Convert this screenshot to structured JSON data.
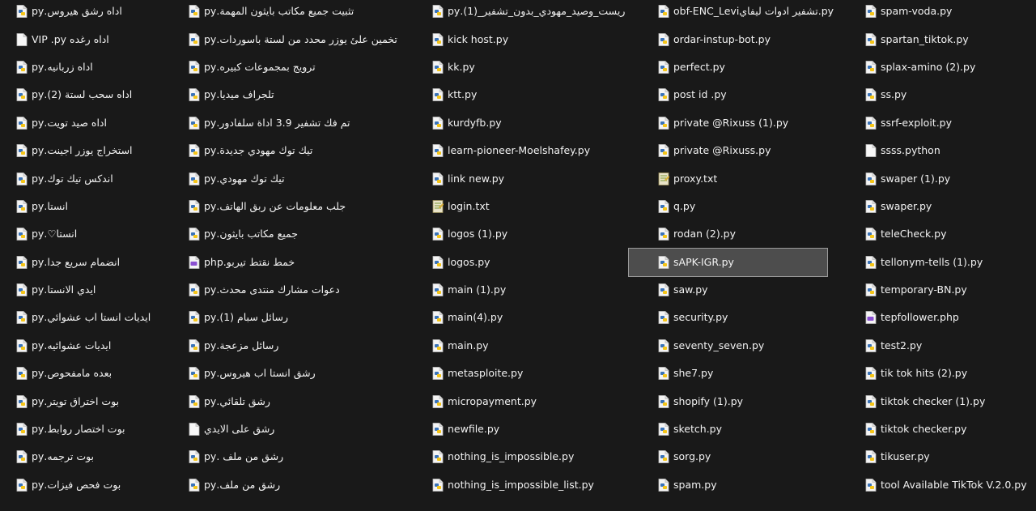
{
  "colors": {
    "background": "#191919",
    "text": "#f2f2f2",
    "selected_bg": "#4d4d4d",
    "selected_border": "#9a9a9a",
    "py_blue": "#3a73b8",
    "py_yellow": "#f5c518",
    "php_purple": "#8a4fd1"
  },
  "columns": [
    {
      "items": [
        {
          "name": "اداه رشق هيروس.py",
          "icon": "python-file-icon"
        },
        {
          "name": "اداه رغده VIP .py",
          "icon": "generic-file-icon"
        },
        {
          "name": "اداه زربانيه.py",
          "icon": "python-file-icon"
        },
        {
          "name": "اداه سحب لستة (2).py",
          "icon": "python-file-icon"
        },
        {
          "name": "اداه صيد تويت.py",
          "icon": "python-file-icon"
        },
        {
          "name": "استخراج يوزر اجينت.py",
          "icon": "python-file-icon"
        },
        {
          "name": "اندكس تيك توك.py",
          "icon": "python-file-icon"
        },
        {
          "name": "انستا.py",
          "icon": "python-file-icon"
        },
        {
          "name": "انستا♡.py",
          "icon": "python-file-icon"
        },
        {
          "name": "انضمام سريع جدا.py",
          "icon": "python-file-icon"
        },
        {
          "name": "ايدي الانستا.py",
          "icon": "python-file-icon"
        },
        {
          "name": "ايديات انستا اب عشوائي.py",
          "icon": "python-file-icon"
        },
        {
          "name": "ايديات عشوائيه.py",
          "icon": "python-file-icon"
        },
        {
          "name": "بعده مامفحوص.py",
          "icon": "python-file-icon"
        },
        {
          "name": "بوت اختراق تويتر.py",
          "icon": "python-file-icon"
        },
        {
          "name": "بوت اختصار روابط.py",
          "icon": "python-file-icon"
        },
        {
          "name": "بوت ترجمه.py",
          "icon": "python-file-icon"
        },
        {
          "name": "بوت فحص فيزات.py",
          "icon": "python-file-icon"
        }
      ]
    },
    {
      "items": [
        {
          "name": "تثبيت جميع مكاتب بايثون المهمة.py",
          "icon": "python-file-icon"
        },
        {
          "name": "تخمين علئ يوزر محدد من لستة باسوردات.py",
          "icon": "python-file-icon"
        },
        {
          "name": "ترويج بمجموعات كبيره.py",
          "icon": "python-file-icon"
        },
        {
          "name": "تلجراف ميديا.py",
          "icon": "python-file-icon"
        },
        {
          "name": "تم فك تشفير 3.9 اداة سلفادور.py",
          "icon": "python-file-icon"
        },
        {
          "name": "تيك توك مهودي جديدة.py",
          "icon": "python-file-icon"
        },
        {
          "name": "تيك توك مهودي.py",
          "icon": "python-file-icon"
        },
        {
          "name": "جلب معلومات عن ربق الهاتف.py",
          "icon": "python-file-icon"
        },
        {
          "name": "جميع مكاتب بايثون.py",
          "icon": "python-file-icon"
        },
        {
          "name": "خمط نقتط تيربو.php",
          "icon": "php-file-icon"
        },
        {
          "name": "دعوات مشارك منتدى محدث.py",
          "icon": "python-file-icon"
        },
        {
          "name": "رسائل سبام  (1).py",
          "icon": "python-file-icon"
        },
        {
          "name": "رسائل مزعجة.py",
          "icon": "python-file-icon"
        },
        {
          "name": "رشق انستا اب هيروس.py",
          "icon": "python-file-icon"
        },
        {
          "name": "رشق تلقائي.py",
          "icon": "python-file-icon"
        },
        {
          "name": "رشق على الايدي",
          "icon": "generic-file-icon"
        },
        {
          "name": "رشق من ملف .py",
          "icon": "python-file-icon"
        },
        {
          "name": "رشق من ملف.py",
          "icon": "python-file-icon"
        }
      ]
    },
    {
      "items": [
        {
          "name": "ريست_وصيد_مهودي_بدون_تشفير_(1).py",
          "icon": "python-file-icon"
        },
        {
          "name": "kick host.py",
          "icon": "python-file-icon"
        },
        {
          "name": "kk.py",
          "icon": "python-file-icon"
        },
        {
          "name": "ktt.py",
          "icon": "python-file-icon"
        },
        {
          "name": "kurdyfb.py",
          "icon": "python-file-icon"
        },
        {
          "name": "learn-pioneer-Moelshafey.py",
          "icon": "python-file-icon"
        },
        {
          "name": "link new.py",
          "icon": "python-file-icon"
        },
        {
          "name": "login.txt",
          "icon": "text-file-icon"
        },
        {
          "name": "logos (1).py",
          "icon": "python-file-icon"
        },
        {
          "name": "logos.py",
          "icon": "python-file-icon"
        },
        {
          "name": "main (1).py",
          "icon": "python-file-icon"
        },
        {
          "name": "main(4).py",
          "icon": "python-file-icon"
        },
        {
          "name": "main.py",
          "icon": "python-file-icon"
        },
        {
          "name": "metasploite.py",
          "icon": "python-file-icon"
        },
        {
          "name": "micropayment.py",
          "icon": "python-file-icon"
        },
        {
          "name": "newfile.py",
          "icon": "python-file-icon"
        },
        {
          "name": "nothing_is_impossible.py",
          "icon": "python-file-icon"
        },
        {
          "name": "nothing_is_impossible_list.py",
          "icon": "python-file-icon"
        }
      ]
    },
    {
      "items": [
        {
          "name": "obf-ENC_Leviتشفير ادوات ليفاي.py",
          "icon": "python-file-icon"
        },
        {
          "name": "ordar-instup-bot.py",
          "icon": "python-file-icon"
        },
        {
          "name": "perfect.py",
          "icon": "python-file-icon"
        },
        {
          "name": "post id .py",
          "icon": "python-file-icon"
        },
        {
          "name": "private @Rixuss (1).py",
          "icon": "python-file-icon"
        },
        {
          "name": "private @Rixuss.py",
          "icon": "python-file-icon"
        },
        {
          "name": "proxy.txt",
          "icon": "text-file-icon"
        },
        {
          "name": "q.py",
          "icon": "python-file-icon"
        },
        {
          "name": "rodan (2).py",
          "icon": "python-file-icon"
        },
        {
          "name": "sAPK-IGR.py",
          "icon": "python-file-icon",
          "selected": true
        },
        {
          "name": "saw.py",
          "icon": "python-file-icon"
        },
        {
          "name": "security.py",
          "icon": "python-file-icon"
        },
        {
          "name": "seventy_seven.py",
          "icon": "python-file-icon"
        },
        {
          "name": "she7.py",
          "icon": "python-file-icon"
        },
        {
          "name": "shopify (1).py",
          "icon": "python-file-icon"
        },
        {
          "name": "sketch.py",
          "icon": "python-file-icon"
        },
        {
          "name": "sorg.py",
          "icon": "python-file-icon"
        },
        {
          "name": "spam.py",
          "icon": "python-file-icon"
        }
      ]
    },
    {
      "items": [
        {
          "name": "spam-voda.py",
          "icon": "python-file-icon"
        },
        {
          "name": "spartan_tiktok.py",
          "icon": "python-file-icon"
        },
        {
          "name": "splax-amino (2).py",
          "icon": "python-file-icon"
        },
        {
          "name": "ss.py",
          "icon": "python-file-icon"
        },
        {
          "name": "ssrf-exploit.py",
          "icon": "python-file-icon"
        },
        {
          "name": "ssss.python",
          "icon": "generic-file-icon"
        },
        {
          "name": "swaper (1).py",
          "icon": "python-file-icon"
        },
        {
          "name": "swaper.py",
          "icon": "python-file-icon"
        },
        {
          "name": "teleCheck.py",
          "icon": "python-file-icon"
        },
        {
          "name": "tellonym-tells (1).py",
          "icon": "python-file-icon"
        },
        {
          "name": "temporary-BN.py",
          "icon": "python-file-icon"
        },
        {
          "name": "tepfollower.php",
          "icon": "php-file-icon"
        },
        {
          "name": "test2.py",
          "icon": "python-file-icon"
        },
        {
          "name": "tik tok hits (2).py",
          "icon": "python-file-icon"
        },
        {
          "name": "tiktok checker (1).py",
          "icon": "python-file-icon"
        },
        {
          "name": "tiktok checker.py",
          "icon": "python-file-icon"
        },
        {
          "name": "tikuser.py",
          "icon": "python-file-icon"
        },
        {
          "name": "tool Available TikTok V.2.0.py",
          "icon": "python-file-icon"
        }
      ]
    }
  ]
}
